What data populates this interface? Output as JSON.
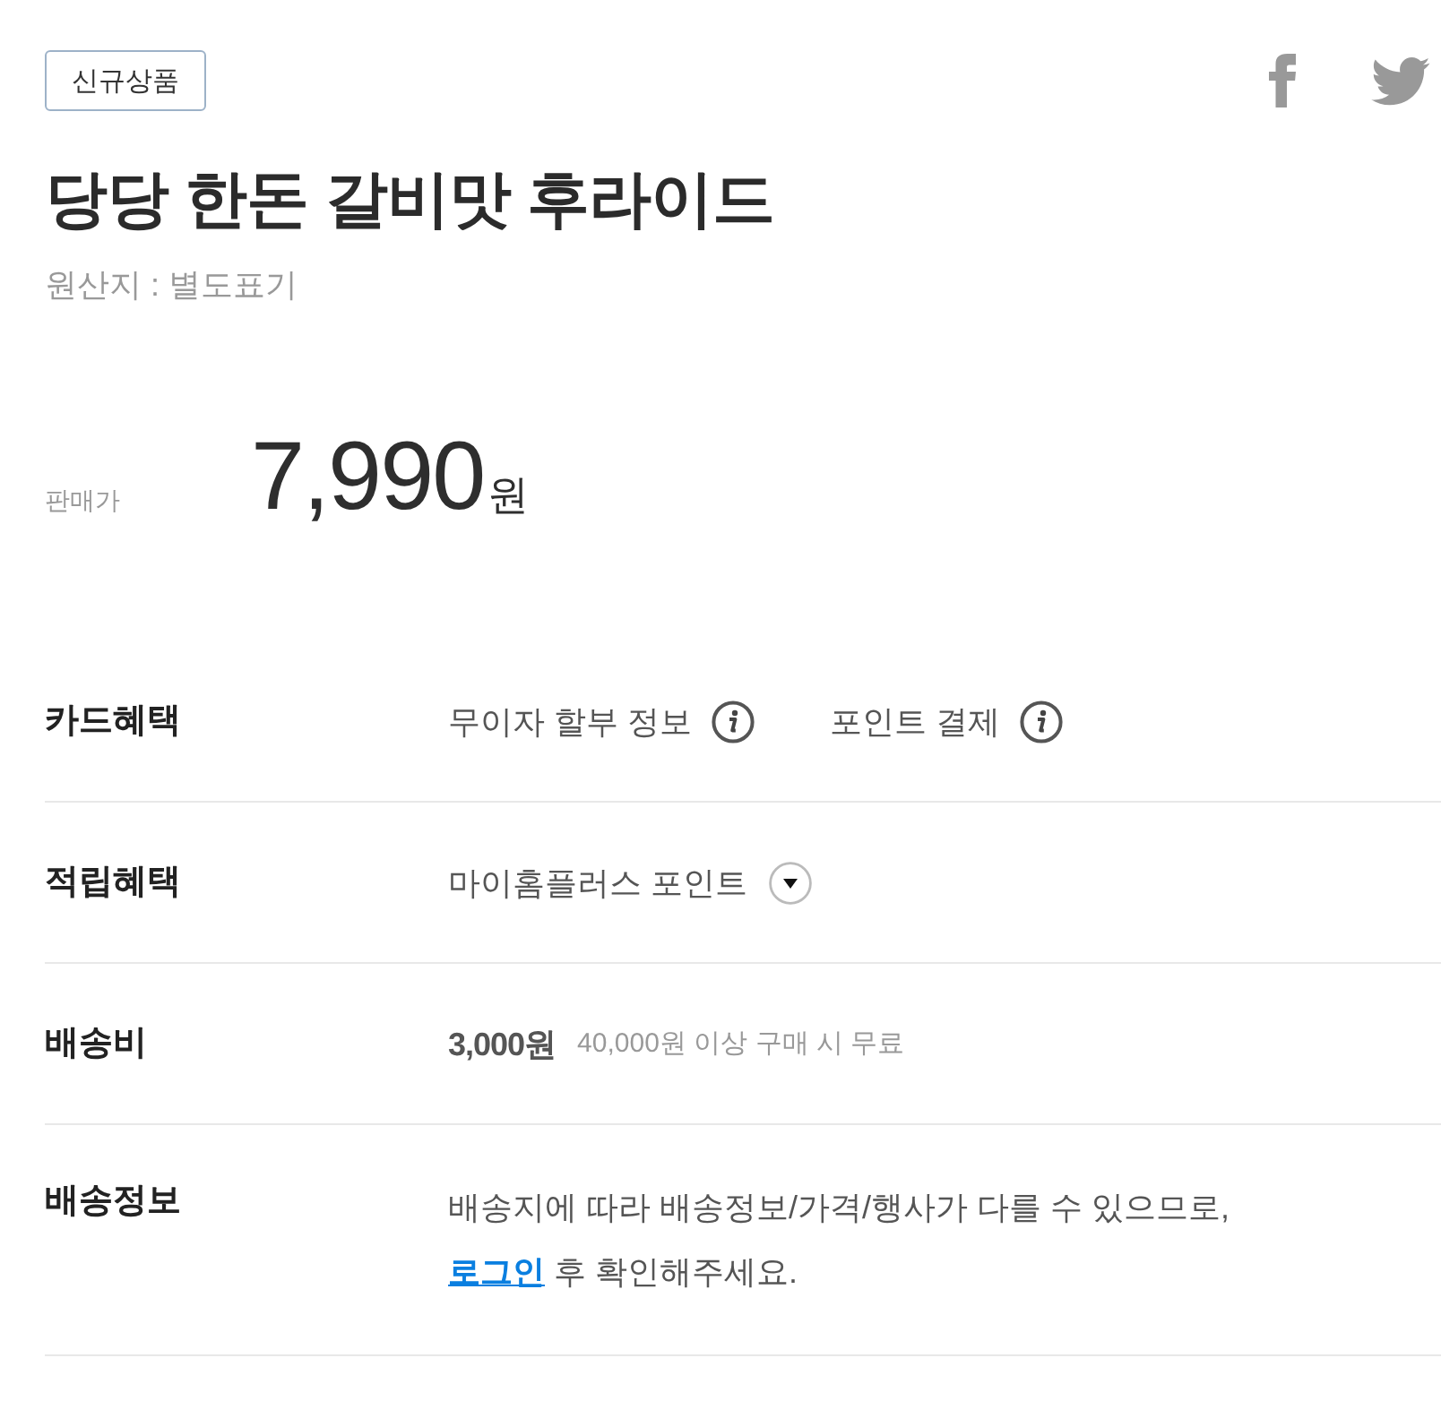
{
  "badge": "신규상품",
  "product": {
    "title": "당당 한돈 갈비맛 후라이드",
    "origin": "원산지 : 별도표기"
  },
  "price": {
    "label": "판매가",
    "amount": "7,990",
    "unit": "원"
  },
  "info_rows": [
    {
      "kind": "info_links",
      "label": "카드혜택",
      "links": [
        "무이자 할부 정보",
        "포인트 결제"
      ]
    },
    {
      "kind": "dropdown",
      "label": "적립혜택",
      "value": "마이홈플러스 포인트",
      "expanded": false
    },
    {
      "kind": "fee",
      "label": "배송비",
      "value": "3,000원",
      "note": "40,000원 이상 구매 시 무료"
    },
    {
      "kind": "notice",
      "label": "배송정보",
      "text_before": "배송지에 따라 배송정보/가격/행사가 다를 수 있으므로,",
      "link": "로그인",
      "text_after": "후 확인해주세요."
    }
  ]
}
